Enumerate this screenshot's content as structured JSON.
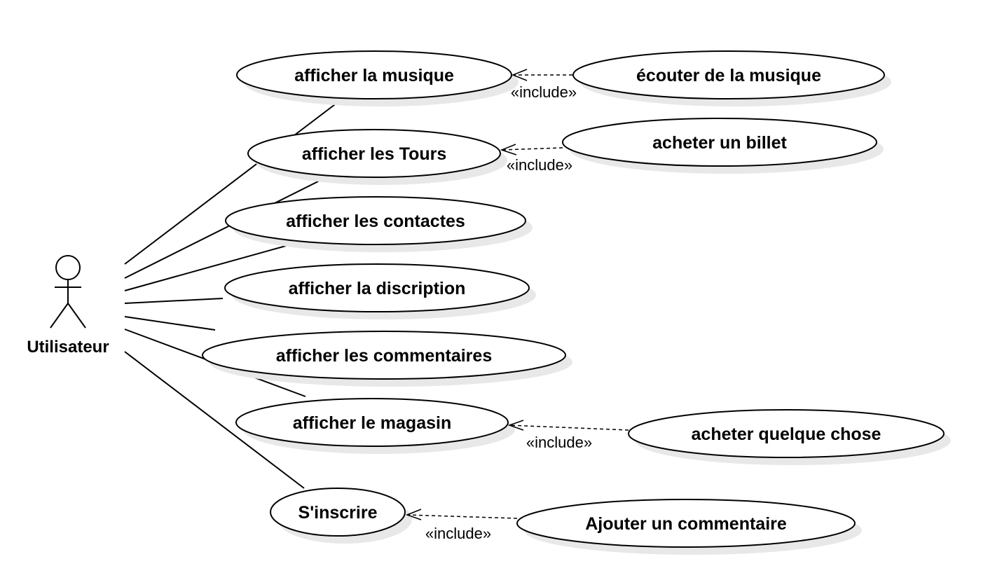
{
  "actor": {
    "label": "Utilisateur"
  },
  "use_cases": {
    "afficher_musique": "afficher la musique",
    "ecouter_musique": "écouter de la musique",
    "afficher_tours": "afficher les Tours",
    "acheter_billet": "acheter un billet",
    "afficher_contactes": "afficher les contactes",
    "afficher_discription": "afficher la discription",
    "afficher_commentaires": "afficher les commentaires",
    "afficher_magasin": "afficher le magasin",
    "acheter_chose": "acheter quelque chose",
    "sinscrire": "S'inscrire",
    "ajouter_commentaire": "Ajouter un commentaire"
  },
  "relations": {
    "include_label": "«include»",
    "includes": [
      {
        "base": "afficher la musique",
        "included": "écouter de la musique"
      },
      {
        "base": "afficher les Tours",
        "included": "acheter un billet"
      },
      {
        "base": "afficher le magasin",
        "included": "acheter quelque chose"
      },
      {
        "base": "S'inscrire",
        "included": "Ajouter un commentaire"
      }
    ]
  }
}
